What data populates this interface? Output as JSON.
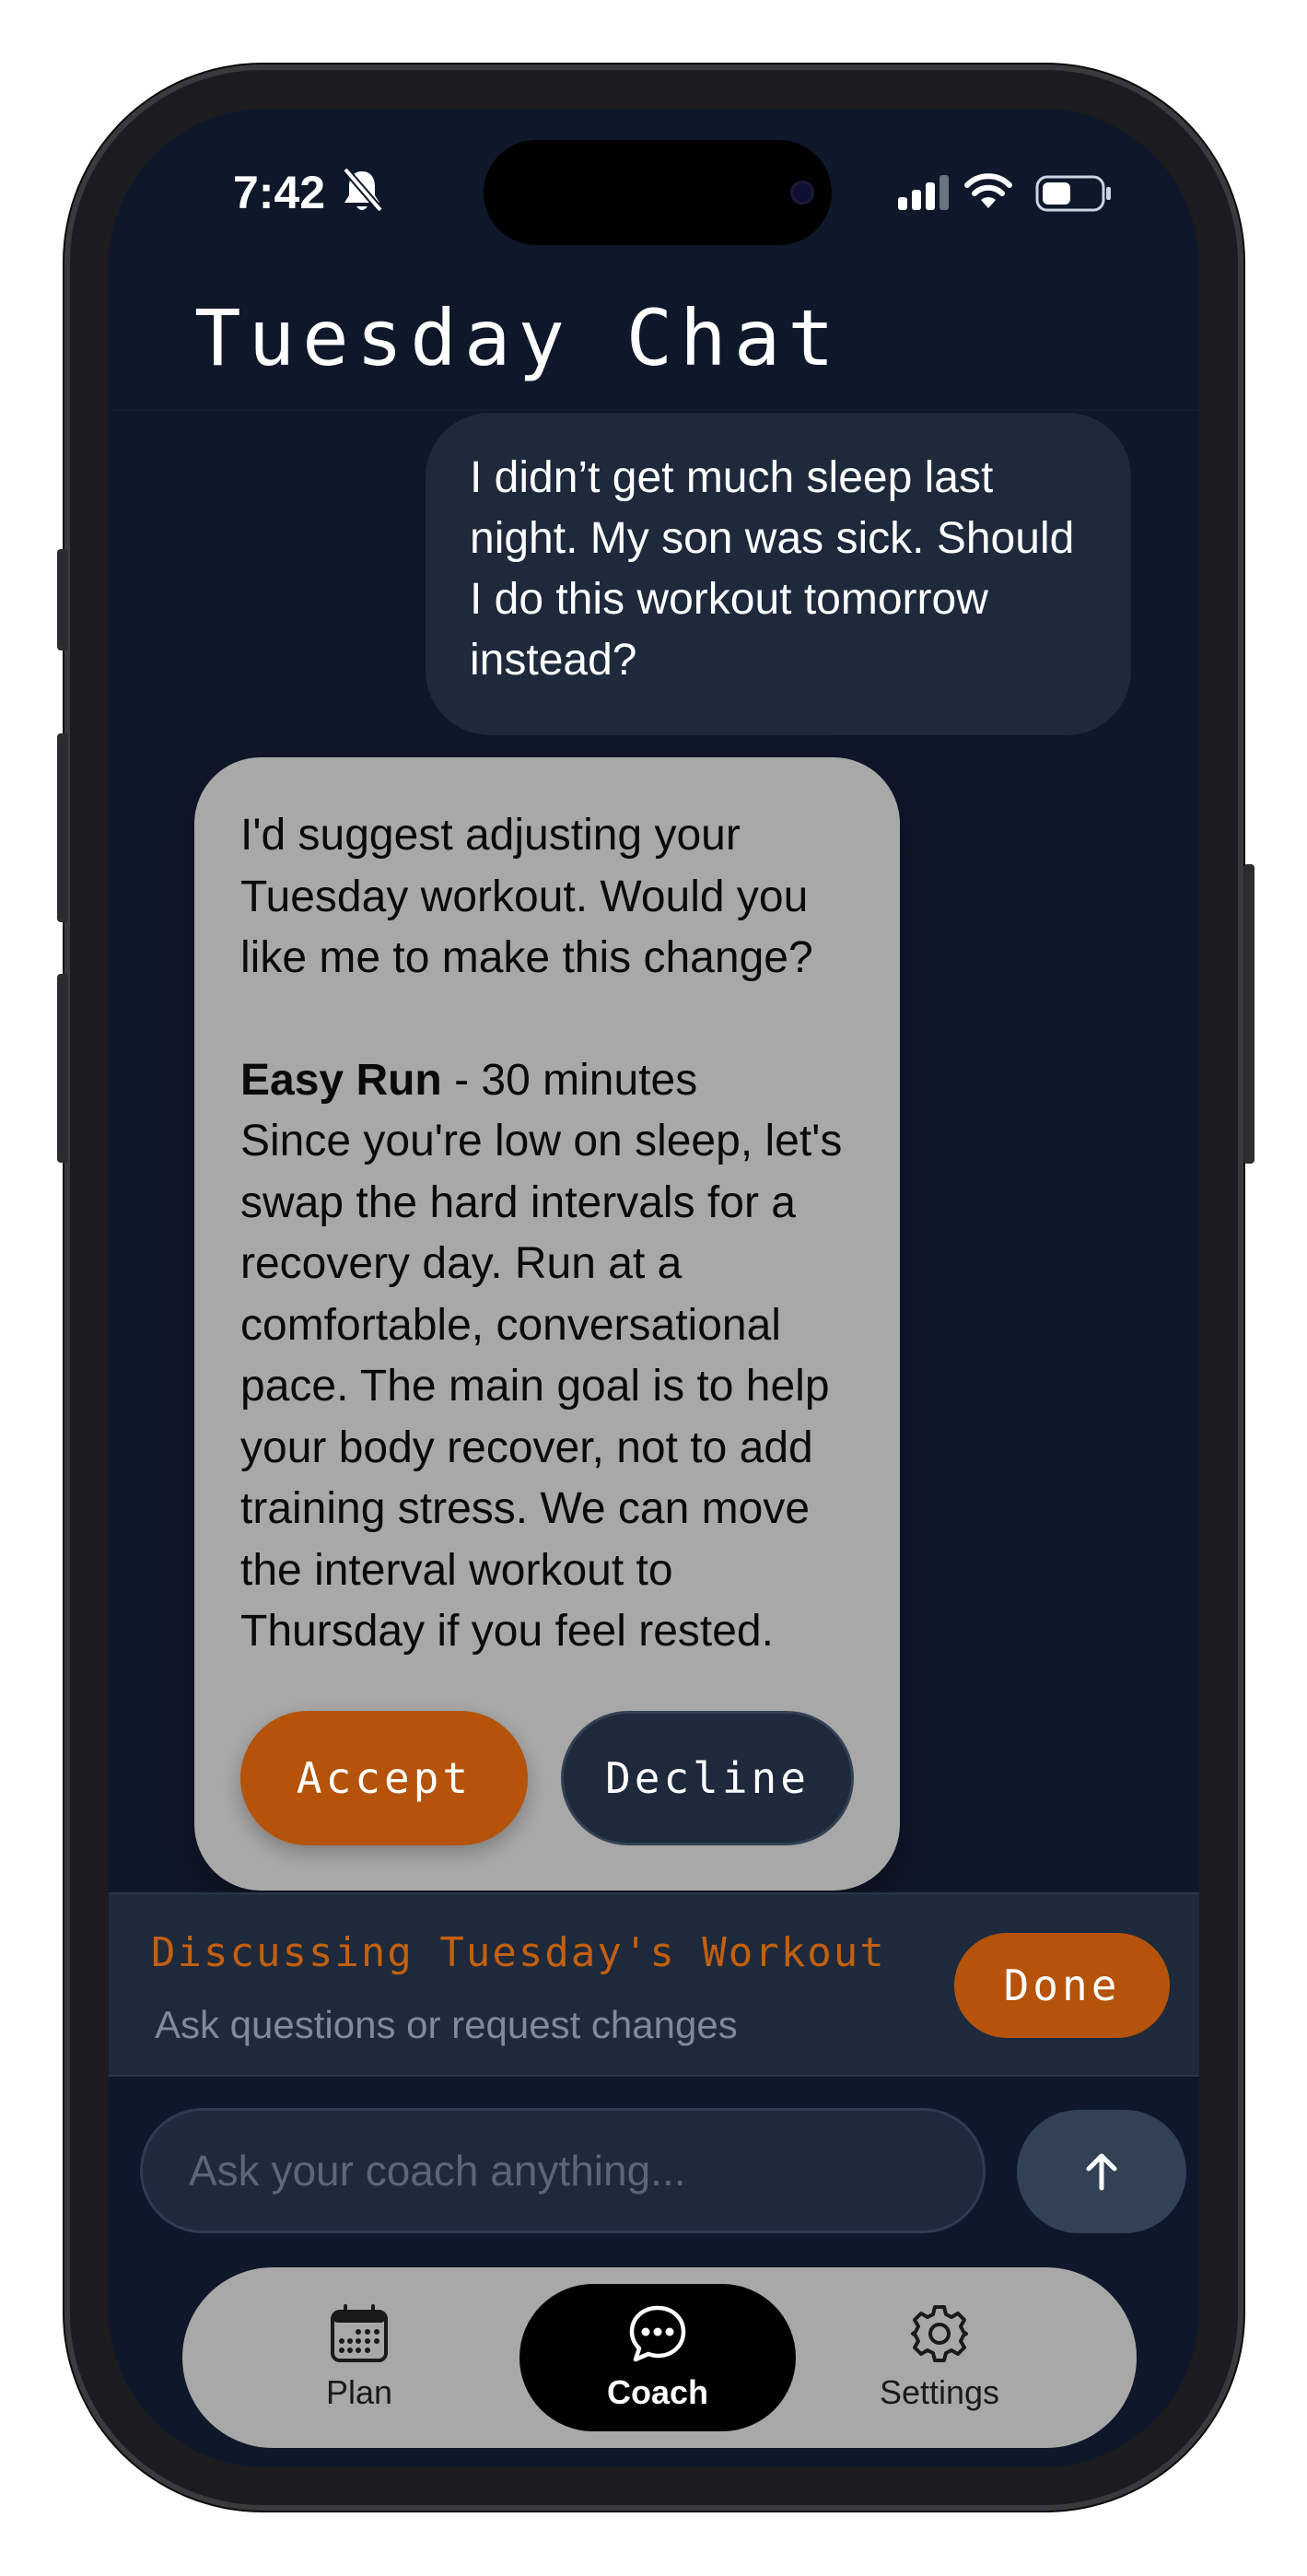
{
  "status_bar": {
    "time": "7:42"
  },
  "header": {
    "title": "Tuesday Chat"
  },
  "messages": {
    "user": "I didn’t get much sleep last night. My son was sick. Should I do this workout tomorrow instead?",
    "coach": {
      "intro": "I'd suggest adjusting your Tuesday workout. Would you like me to make this change?",
      "workout_name": "Easy Run",
      "workout_duration": " - 30 minutes",
      "details": "Since you're low on sleep, let's swap the hard intervals for a recovery day. Run at a comfortable, conversational pace. The main goal is to help your body recover, not to add training stress. We can move the interval workout to Thursday if you feel rested.",
      "accept_label": "Accept",
      "decline_label": "Decline"
    }
  },
  "context_banner": {
    "title": "Discussing Tuesday's Workout",
    "subtitle": "Ask questions or request changes",
    "done_label": "Done"
  },
  "composer": {
    "placeholder": "Ask your coach anything..."
  },
  "tabs": [
    {
      "label": "Plan",
      "icon": "calendar-icon",
      "active": false
    },
    {
      "label": "Coach",
      "icon": "chat-bubble-icon",
      "active": true
    },
    {
      "label": "Settings",
      "icon": "gear-icon",
      "active": false
    }
  ],
  "colors": {
    "background": "#0f172a",
    "surface": "#1e293b",
    "accent": "#b45309",
    "bubble_coach": "#a8a8a8"
  }
}
